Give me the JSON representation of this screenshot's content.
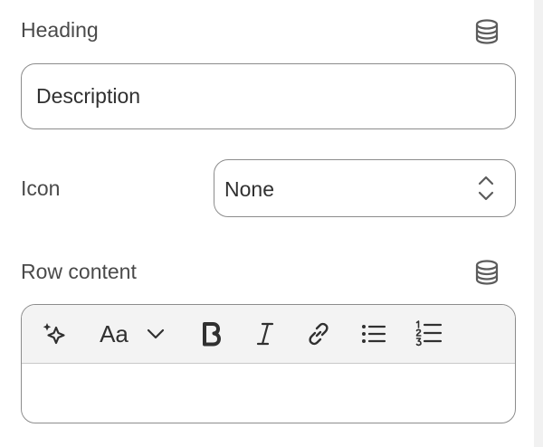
{
  "heading": {
    "label": "Heading",
    "value": "Description",
    "source_icon": "database-icon"
  },
  "icon_setting": {
    "label": "Icon",
    "selected": "None",
    "chevron_icon": "select-chevrons-icon"
  },
  "row_content": {
    "label": "Row content",
    "source_icon": "database-icon",
    "toolbar": {
      "items": [
        {
          "name": "ai-sparkle",
          "icon": "sparkle-icon"
        },
        {
          "name": "text-style",
          "icon": "text-style-icon",
          "text": "Aa"
        },
        {
          "name": "text-style-dropdown",
          "icon": "chevron-down-icon"
        },
        {
          "name": "bold",
          "icon": "bold-icon"
        },
        {
          "name": "italic",
          "icon": "italic-icon"
        },
        {
          "name": "link",
          "icon": "link-icon"
        },
        {
          "name": "bullet-list",
          "icon": "bullet-list-icon"
        },
        {
          "name": "numbered-list",
          "icon": "numbered-list-icon"
        }
      ]
    },
    "body_text": ""
  },
  "colors": {
    "text": "#303030",
    "label": "#4a4a4a",
    "border": "#8c8c8c",
    "toolbar_bg": "#f3f3f3"
  }
}
